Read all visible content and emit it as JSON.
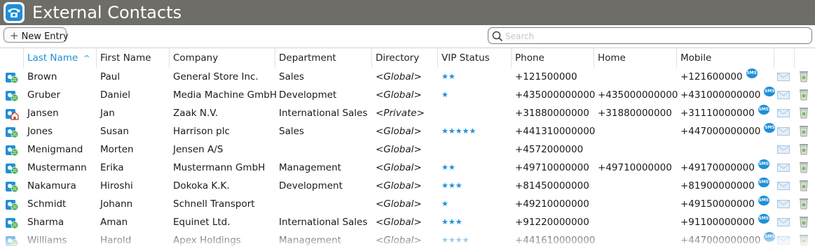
{
  "app": {
    "title": "External Contacts",
    "accent": "#1e8fd8",
    "titlebar_color": "#6e6d68"
  },
  "toolbar": {
    "new_entry_label": "New Entry",
    "search_placeholder": "Search",
    "search_value": ""
  },
  "table": {
    "sort_column": "Last Name",
    "sort_direction": "ascending",
    "columns": [
      "Last Name",
      "First Name",
      "Company",
      "Department",
      "Directory",
      "VIP Status",
      "Phone",
      "Home",
      "Mobile"
    ],
    "rows": [
      {
        "last": "Brown",
        "first": "Paul",
        "company": "General Store Inc.",
        "department": "Sales",
        "directory": "<Global>",
        "vip": 2,
        "phone": "+121500000",
        "home": "",
        "mobile": "+121600000",
        "sms": true,
        "type": "global"
      },
      {
        "last": "Gruber",
        "first": "Daniel",
        "company": "Media Machine GmbH",
        "department": "Developmet",
        "directory": "<Global>",
        "vip": 1,
        "phone": "+435000000000",
        "home": "+435000000000",
        "mobile": "+431000000000",
        "sms": true,
        "type": "global"
      },
      {
        "last": "Jansen",
        "first": "Jan",
        "company": "Zaak N.V.",
        "department": "International Sales",
        "directory": "<Private>",
        "vip": 0,
        "phone": "+31880000000",
        "home": "+31880000000",
        "mobile": "+31110000000",
        "sms": true,
        "type": "private"
      },
      {
        "last": "Jones",
        "first": "Susan",
        "company": "Harrison plc",
        "department": "Sales",
        "directory": "<Global>",
        "vip": 5,
        "phone": "+441310000000",
        "home": "",
        "mobile": "+447000000000",
        "sms": true,
        "type": "global"
      },
      {
        "last": "Menigmand",
        "first": "Morten",
        "company": "Jensen A/S",
        "department": "",
        "directory": "<Global>",
        "vip": 0,
        "phone": "+4572000000",
        "home": "",
        "mobile": "",
        "sms": false,
        "type": "global"
      },
      {
        "last": "Mustermann",
        "first": "Erika",
        "company": "Mustermann GmbH",
        "department": "Management",
        "directory": "<Global>",
        "vip": 2,
        "phone": "+49710000000",
        "home": "+49710000000",
        "mobile": "+49170000000",
        "sms": true,
        "type": "global"
      },
      {
        "last": "Nakamura",
        "first": "Hiroshi",
        "company": "Dokoka K.K.",
        "department": "Development",
        "directory": "<Global>",
        "vip": 3,
        "phone": "+81450000000",
        "home": "",
        "mobile": "+81900000000",
        "sms": true,
        "type": "global"
      },
      {
        "last": "Schmidt",
        "first": "Johann",
        "company": "Schnell Transport",
        "department": "",
        "directory": "<Global>",
        "vip": 1,
        "phone": "+49210000000",
        "home": "",
        "mobile": "+49150000000",
        "sms": true,
        "type": "global"
      },
      {
        "last": "Sharma",
        "first": "Aman",
        "company": "Equinet Ltd.",
        "department": "International Sales",
        "directory": "<Global>",
        "vip": 3,
        "phone": "+91220000000",
        "home": "",
        "mobile": "+91100000000",
        "sms": true,
        "type": "global"
      },
      {
        "last": "Williams",
        "first": "Harold",
        "company": "Apex Holdings",
        "department": "Management",
        "directory": "<Global>",
        "vip": 4,
        "phone": "+441610000000",
        "home": "",
        "mobile": "+447000000000",
        "sms": true,
        "type": "global"
      }
    ],
    "sms_label": "SMS",
    "row_icons": {
      "global": "globe-contact-icon",
      "private": "house-contact-icon"
    }
  }
}
